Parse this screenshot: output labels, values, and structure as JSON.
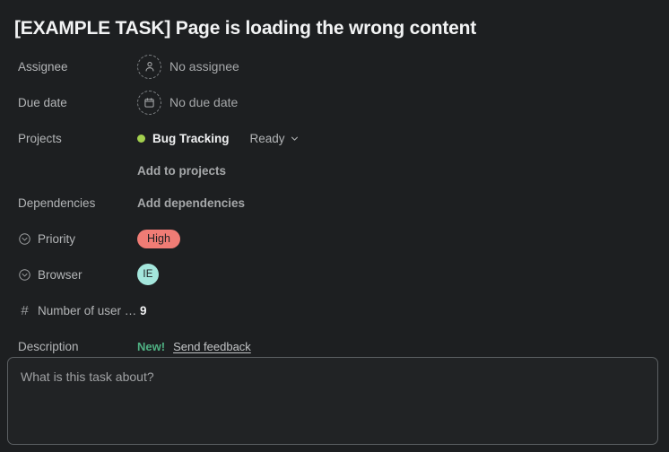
{
  "task": {
    "title": "[EXAMPLE TASK] Page is loading the wrong content"
  },
  "fields": {
    "assignee": {
      "label": "Assignee",
      "value": "No assignee",
      "icon": "user-placeholder-icon"
    },
    "due_date": {
      "label": "Due date",
      "value": "No due date",
      "icon": "calendar-placeholder-icon"
    },
    "projects": {
      "label": "Projects",
      "project_name": "Bug Tracking",
      "project_dot_color": "#a3d04e",
      "status": "Ready",
      "add_label": "Add to projects"
    },
    "dependencies": {
      "label": "Dependencies",
      "add_label": "Add dependencies"
    },
    "priority": {
      "label": "Priority",
      "icon": "single-select-icon",
      "value": "High",
      "pill_color": "#f07c75"
    },
    "browser": {
      "label": "Browser",
      "icon": "single-select-icon",
      "value": "IE",
      "badge_color": "#a4e6dc"
    },
    "user_reports": {
      "label": "Number of user r…",
      "icon": "number-icon",
      "value": "9"
    },
    "description": {
      "label": "Description",
      "new_tag": "New!",
      "feedback_link": "Send feedback",
      "placeholder": "What is this task about?",
      "value": ""
    }
  }
}
